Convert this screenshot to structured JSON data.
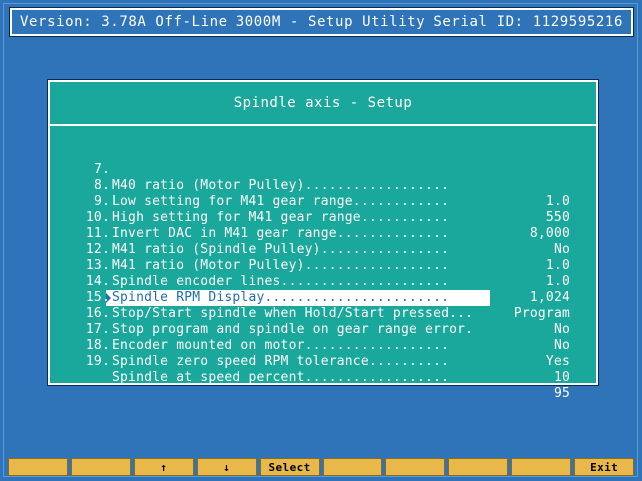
{
  "header": {
    "version": "Version: 3.78A Off-Line",
    "title": "3000M - Setup Utility",
    "serial": "Serial ID: 1129595216"
  },
  "panel": {
    "title": "Spindle axis - Setup"
  },
  "rows": [
    {
      "num": "7.",
      "label": "M40 ratio (Motor Pulley)..................",
      "value": "1.0"
    },
    {
      "num": "8.",
      "label": "Low setting for M41 gear range............",
      "value": "550"
    },
    {
      "num": "9.",
      "label": "High setting for M41 gear range...........",
      "value": "8,000"
    },
    {
      "num": "10.",
      "label": "Invert DAC in M41 gear range..............",
      "value": "No"
    },
    {
      "num": "11.",
      "label": "M41 ratio (Spindle Pulley)................",
      "value": "1.0"
    },
    {
      "num": "12.",
      "label": "M41 ratio (Motor Pulley)..................",
      "value": "1.0"
    },
    {
      "num": "13.",
      "label": "Spindle encoder lines.....................",
      "value": "1,024"
    },
    {
      "num": "14.",
      "label": "Spindle RPM Display.......................",
      "value": "Program",
      "selected": true
    },
    {
      "num": "15.",
      "label": "Stop/Start spindle when Hold/Start pressed....",
      "value": "No"
    },
    {
      "num": "16.",
      "label": "Stop program and spindle on gear range error..",
      "value": "No"
    },
    {
      "num": "17.",
      "label": "Encoder mounted on motor..................",
      "value": "Yes"
    },
    {
      "num": "18.",
      "label": "Spindle zero speed RPM tolerance..........",
      "value": "10"
    },
    {
      "num": "19.",
      "label": "Spindle at speed percent..................",
      "value": "95"
    }
  ],
  "function_keys": [
    {
      "label": ""
    },
    {
      "label": ""
    },
    {
      "label": "↑",
      "icon": "arrow-up-icon"
    },
    {
      "label": "↓",
      "icon": "arrow-down-icon"
    },
    {
      "label": "Select"
    },
    {
      "label": ""
    },
    {
      "label": ""
    },
    {
      "label": ""
    },
    {
      "label": ""
    },
    {
      "label": "Exit"
    }
  ],
  "colors": {
    "background": "#2f74b8",
    "panel": "#1aa89c",
    "function_key": "#e8b94a",
    "selection": "#ffffff"
  }
}
